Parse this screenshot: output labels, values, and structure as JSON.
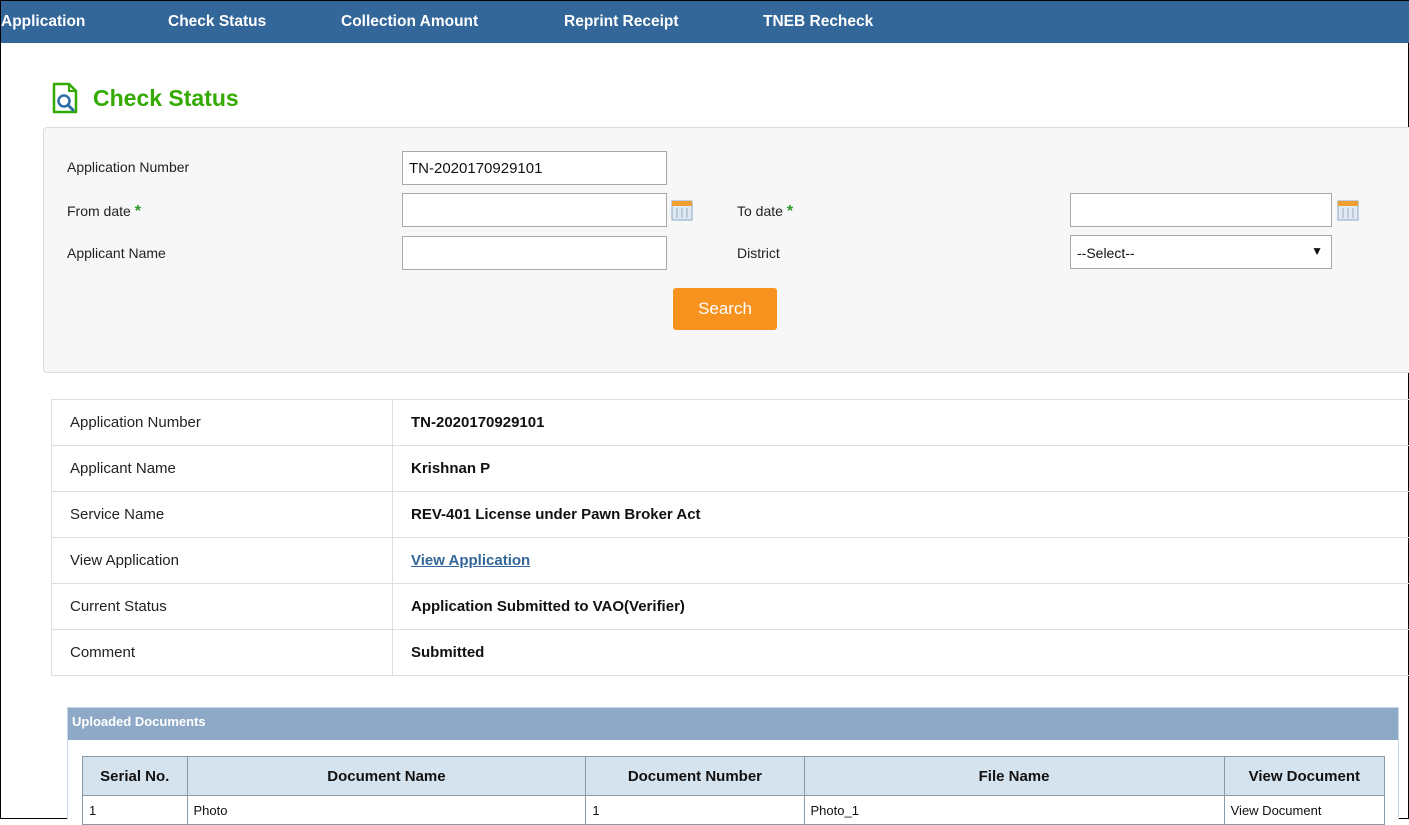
{
  "nav": {
    "items": [
      "Application",
      "Check Status",
      "Collection Amount",
      "Reprint Receipt",
      "TNEB Recheck"
    ]
  },
  "page": {
    "title": "Check Status"
  },
  "search": {
    "app_number_label": "Application Number",
    "app_number_value": "TN-2020170929101",
    "from_date_label": "From date",
    "to_date_label": "To date",
    "required_mark": "*",
    "applicant_name_label": "Applicant Name",
    "district_label": "District",
    "district_value": "--Select--",
    "search_button": "Search"
  },
  "details": {
    "rows": [
      {
        "label": "Application Number",
        "value": "TN-2020170929101"
      },
      {
        "label": "Applicant Name",
        "value": "Krishnan P"
      },
      {
        "label": "Service Name",
        "value": "REV-401 License under Pawn Broker Act"
      },
      {
        "label": "View Application",
        "value": "View Application"
      },
      {
        "label": "Current Status",
        "value": "Application Submitted to VAO(Verifier)"
      },
      {
        "label": "Comment",
        "value": "Submitted"
      }
    ]
  },
  "documents": {
    "title": "Uploaded Documents",
    "headers": [
      "Serial No.",
      "Document Name",
      "Document Number",
      "File Name",
      "View Document"
    ],
    "rows": [
      [
        "1",
        "Photo",
        "1",
        "Photo_1",
        "View Document"
      ]
    ]
  },
  "colors": {
    "nav_bg": "#336699",
    "title_green": "#33aa00",
    "search_button": "#f7921e",
    "link": "#336699",
    "docs_header": "#8ea9c8"
  }
}
